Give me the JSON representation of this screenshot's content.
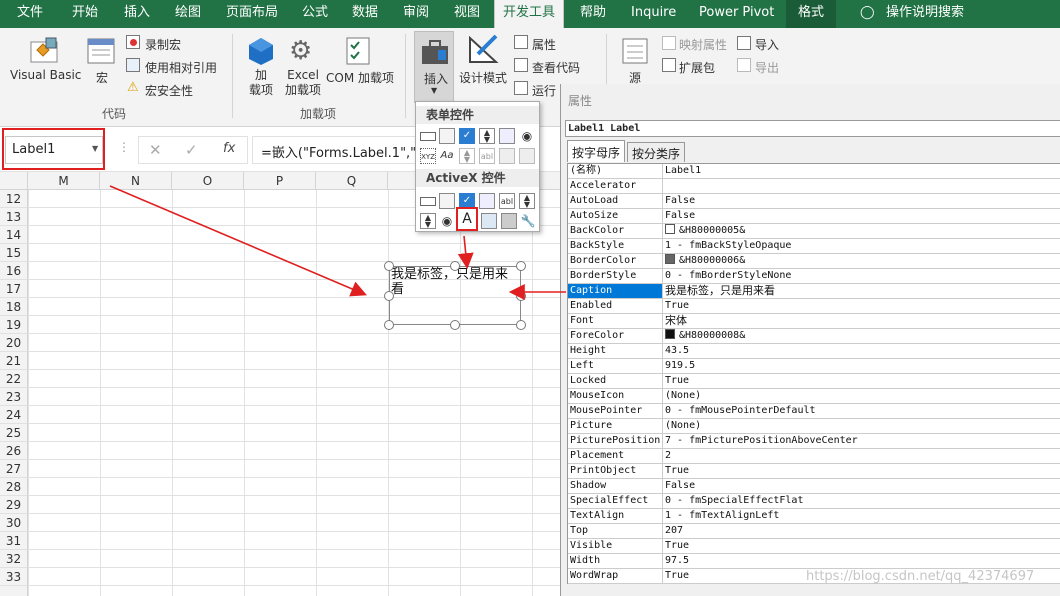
{
  "ribbon_tabs": [
    "文件",
    "开始",
    "插入",
    "绘图",
    "页面布局",
    "公式",
    "数据",
    "审阅",
    "视图",
    "开发工具",
    "帮助",
    "Inquire",
    "Power Pivot",
    "格式",
    "操作说明搜索"
  ],
  "ribbon": {
    "visual_basic": "Visual Basic",
    "macros": "宏",
    "record_macro": "录制宏",
    "relative_refs": "使用相对引用",
    "macro_security": "宏安全性",
    "group_code": "代码",
    "addins": "加\n载项",
    "excel_addins": "Excel\n加载项",
    "com_addins": "COM 加载项",
    "group_addins": "加载项",
    "insert": "插入",
    "design_mode": "设计模式",
    "properties": "属性",
    "view_code": "查看代码",
    "run_dialog": "运行",
    "source": "源",
    "map_props": "映射属性",
    "expansion_packs": "扩展包",
    "import": "导入",
    "export": "导出"
  },
  "namebox": {
    "value": "Label1"
  },
  "formula": {
    "fx": "fx",
    "value": "=嵌入(\"Forms.Label.1\",\"\")"
  },
  "columns": [
    "M",
    "N",
    "O",
    "P",
    "Q"
  ],
  "rows": [
    "12",
    "13",
    "14",
    "15",
    "16",
    "17",
    "18",
    "19",
    "20",
    "21",
    "22",
    "23",
    "24",
    "25",
    "26",
    "27",
    "28",
    "29",
    "30",
    "31",
    "32",
    "33"
  ],
  "dropdown": {
    "form_controls": "表单控件",
    "activex_controls": "ActiveX 控件",
    "label_glyph": "A"
  },
  "label_control": {
    "caption": "我是标签，只是用来看"
  },
  "properties_pane": {
    "title": "属性",
    "object": "Label1 Label",
    "tab_alpha": "按字母序",
    "tab_category": "按分类序",
    "rows": [
      {
        "name": "(名称)",
        "value": "Label1"
      },
      {
        "name": "Accelerator",
        "value": ""
      },
      {
        "name": "AutoLoad",
        "value": "False"
      },
      {
        "name": "AutoSize",
        "value": "False"
      },
      {
        "name": "BackColor",
        "value": "&H80000005&"
      },
      {
        "name": "BackStyle",
        "value": "1 - fmBackStyleOpaque"
      },
      {
        "name": "BorderColor",
        "value": "&H80000006&"
      },
      {
        "name": "BorderStyle",
        "value": "0 - fmBorderStyleNone"
      },
      {
        "name": "Caption",
        "value": "我是标签，只是用来看"
      },
      {
        "name": "Enabled",
        "value": "True"
      },
      {
        "name": "Font",
        "value": "宋体"
      },
      {
        "name": "ForeColor",
        "value": "&H80000008&"
      },
      {
        "name": "Height",
        "value": "43.5"
      },
      {
        "name": "Left",
        "value": "919.5"
      },
      {
        "name": "Locked",
        "value": "True"
      },
      {
        "name": "MouseIcon",
        "value": "(None)"
      },
      {
        "name": "MousePointer",
        "value": "0 - fmMousePointerDefault"
      },
      {
        "name": "Picture",
        "value": "(None)"
      },
      {
        "name": "PicturePosition",
        "value": "7 - fmPicturePositionAboveCenter"
      },
      {
        "name": "Placement",
        "value": "2"
      },
      {
        "name": "PrintObject",
        "value": "True"
      },
      {
        "name": "Shadow",
        "value": "False"
      },
      {
        "name": "SpecialEffect",
        "value": "0 - fmSpecialEffectFlat"
      },
      {
        "name": "TextAlign",
        "value": "1 - fmTextAlignLeft"
      },
      {
        "name": "Top",
        "value": "207"
      },
      {
        "name": "Visible",
        "value": "True"
      },
      {
        "name": "Width",
        "value": "97.5"
      },
      {
        "name": "WordWrap",
        "value": "True"
      }
    ]
  },
  "watermark": "https://blog.csdn.net/qq_42374697",
  "colors": {
    "excel_green": "#217346",
    "annotation_red": "#e02020",
    "selection_blue": "#0078d7"
  }
}
